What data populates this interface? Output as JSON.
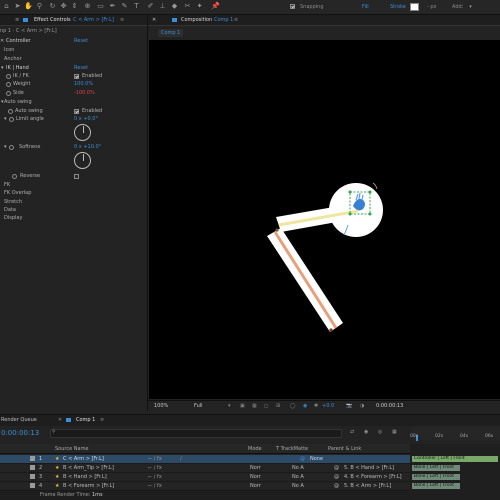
{
  "toolbar": {
    "snapping_label": "Snapping",
    "fill_label": "Fill",
    "stroke_label": "Stroke",
    "stroke_px": "- px",
    "add_label": "Add:",
    "tools": [
      "home-icon",
      "select-icon",
      "hand-icon",
      "zoom-icon",
      "orbit-icon",
      "pan-icon",
      "dolly-icon",
      "pan-behind-icon",
      "rect-icon",
      "pen-icon",
      "type-icon",
      "brush-icon",
      "stamp-icon",
      "eraser-icon",
      "roto-icon",
      "puppet-icon"
    ]
  },
  "effect_controls": {
    "tab_label": "Effect Controls",
    "tab_layer": "C < Arm > [Fr.L]",
    "breadcrumb": "np 1 · C < Arm > [Fr.L]",
    "controller_label": "Controller",
    "controller_reset": "Reset",
    "icon_label": "Icon",
    "anchor_label": "Anchor",
    "ik_hand_label": "IK | Hand",
    "ik_hand_reset": "Reset",
    "ik_fk_label": "IK / FK",
    "ik_fk_value": "Enabled",
    "weight_label": "Weight",
    "weight_value": "100.0%",
    "side_label": "Side",
    "side_value": "-100.0%",
    "autoswing_group": "Auto swing",
    "autoswing_label": "Auto swing",
    "autoswing_value": "Enabled",
    "limit_angle_label": "Limit angle",
    "limit_angle_value": "0 x +0.0°",
    "softness_label": "Softness",
    "softness_value": "0 x +10.0°",
    "reverse_label": "Reverse",
    "fk_label": "FK",
    "fk_overlap_label": "FK Overlap",
    "stretch_label": "Stretch",
    "data_label": "Data",
    "display_label": "Display"
  },
  "composition": {
    "tab_label": "Composition",
    "comp_name": "Comp 1",
    "sub_tab": "Comp 1",
    "zoom": "100%",
    "resolution": "Full",
    "exposure": "+0.0",
    "timecode": "0:00:00:13"
  },
  "timeline": {
    "render_queue_tab": "Render Queue",
    "comp_tab": "Comp 1",
    "current_time": "0:00:00:13",
    "search_placeholder": "",
    "col_source": "Source Name",
    "col_mode": "Mode",
    "col_trkmat": "T TrackMatte",
    "col_parent": "Parent & Link",
    "ruler_ticks": [
      "00s",
      "02s",
      "04s",
      "06s"
    ],
    "layers": [
      {
        "num": "1",
        "name": "C < Arm > [Fr.L]",
        "mode": "",
        "trkmat": "",
        "parent": "None",
        "bar": "Controller | Left | Front",
        "selected": true
      },
      {
        "num": "2",
        "name": "B < Arm_Tip > [Fr.L]",
        "mode": "Norr",
        "trkmat": "No A",
        "parent": "5. B < Hand > [Fr.L]",
        "bar": "Bone | Left | Front",
        "selected": false
      },
      {
        "num": "3",
        "name": "B < Hand > [Fr.L]",
        "mode": "Norr",
        "trkmat": "No A",
        "parent": "4. B < Forearm > [Fr.L]",
        "bar": "Bone | Left | Front",
        "selected": false
      },
      {
        "num": "4",
        "name": "B < Forearm > [Fr.L]",
        "mode": "Norr",
        "trkmat": "No A",
        "parent": "5. B < Arm > [Fr.L]",
        "bar": "Bone | Left | Front",
        "selected": false
      }
    ],
    "status_label": "Frame Render Time:",
    "status_value": "1ms"
  },
  "colors": {
    "accent": "#3a8fd6",
    "side_value": "#d64545",
    "bone_fill": "#ffffff",
    "bone_upper_line": "#f0e6a0",
    "bone_lower_line": "#e8a07a",
    "controller_green": "#2fa84f",
    "track_bar": "#6f8a79"
  }
}
